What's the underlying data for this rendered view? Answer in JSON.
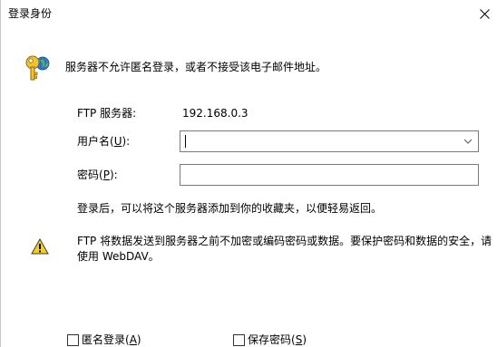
{
  "window": {
    "title": "登录身份",
    "close_glyph": "✕"
  },
  "header": {
    "icon": "key-globe-icon",
    "message": "服务器不允许匿名登录，或者不接受该电子邮件地址。"
  },
  "server": {
    "label": "FTP 服务器:",
    "value": "192.168.0.3"
  },
  "username": {
    "label_prefix": "用户名(",
    "label_mnemonic": "U",
    "label_suffix": "):",
    "value": ""
  },
  "password": {
    "label_prefix": "密码(",
    "label_mnemonic": "P",
    "label_suffix": "):",
    "value": ""
  },
  "info": {
    "text": "登录后，可以将这个服务器添加到你的收藏夹，以便轻易返回。"
  },
  "warning": {
    "icon": "warning-icon",
    "text": "FTP 将数据发送到服务器之前不加密或编码密码或数据。要保护密码和数据的安全，请使用 WebDAV。"
  },
  "options": {
    "anonymous_prefix": "匿名登录(",
    "anonymous_mnemonic": "A",
    "anonymous_suffix": ")",
    "save_prefix": "保存密码(",
    "save_mnemonic": "S",
    "save_suffix": ")"
  }
}
